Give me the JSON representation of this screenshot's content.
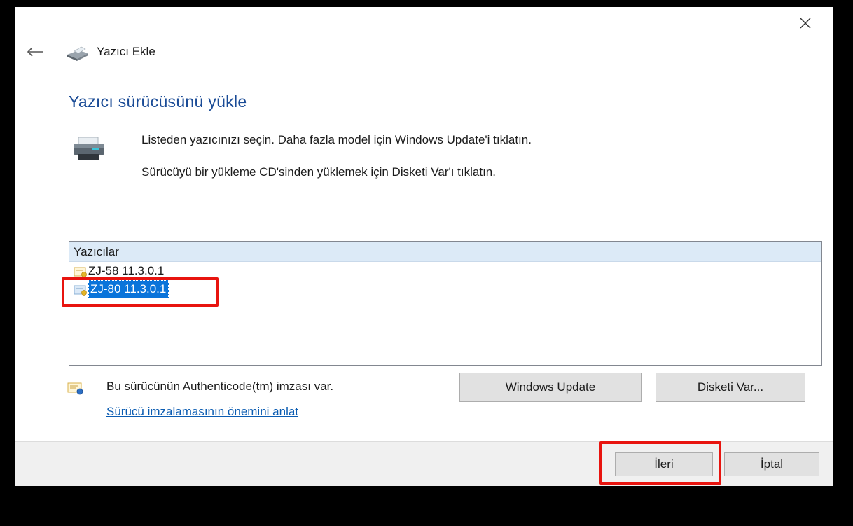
{
  "window": {
    "title": "Yazıcı Ekle",
    "close_glyph": "✕",
    "back_glyph": "←"
  },
  "page": {
    "heading": "Yazıcı sürücüsünü yükle",
    "instruction_1": "Listeden yazıcınızı seçin. Daha fazla model için Windows Update'i tıklatın.",
    "instruction_2": "Sürücüyü bir yükleme CD'sinden yüklemek için Disketi Var'ı tıklatın."
  },
  "printers": {
    "header": "Yazıcılar",
    "items": [
      {
        "label": "ZJ-58 11.3.0.1",
        "selected": false,
        "icon": "certificate-icon"
      },
      {
        "label": "ZJ-80 11.3.0.1",
        "selected": true,
        "icon": "certificate-icon"
      }
    ]
  },
  "signature": {
    "text": "Bu sürücünün Authenticode(tm) imzası var.",
    "link": "Sürücü imzalamasının önemini anlat",
    "icon": "signed-certificate-icon"
  },
  "buttons": {
    "windows_update": "Windows Update",
    "have_disk": "Disketi Var...",
    "next": "İleri",
    "cancel": "İptal"
  },
  "annotations": {
    "highlight_color": "#e8140f",
    "highlighted": [
      "ZJ-80 11.3.0.1",
      "İleri"
    ]
  },
  "colors": {
    "heading": "#1a4b96",
    "selection": "#0a74da",
    "link": "#0b5cb2",
    "list_header": "#dceaf7"
  }
}
